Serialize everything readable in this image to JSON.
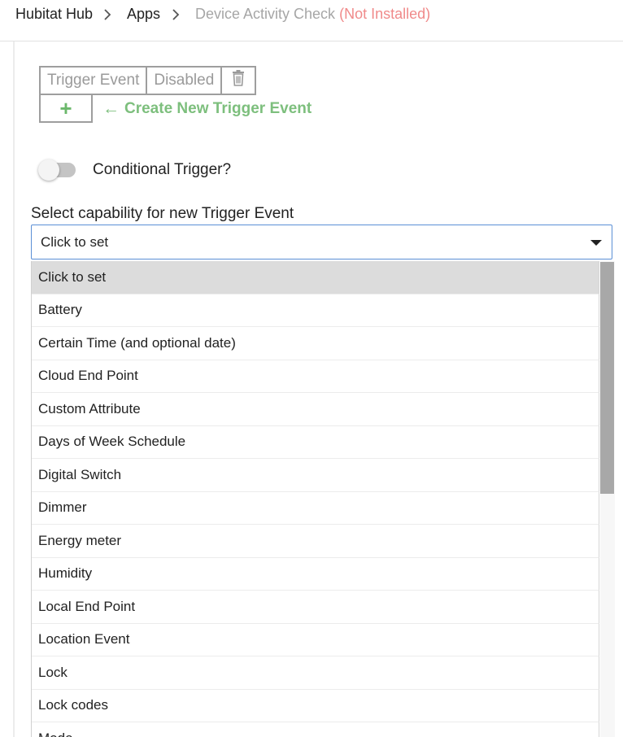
{
  "breadcrumb": {
    "hub": "Hubitat Hub",
    "apps": "Apps",
    "current": "Device Activity Check",
    "status": "(Not Installed)"
  },
  "trigger_table": {
    "event": "Trigger Event",
    "status": "Disabled",
    "add_symbol": "+",
    "create_arrow": "←",
    "create_label": "Create New Trigger Event"
  },
  "conditional": {
    "label": "Conditional Trigger?",
    "enabled": false
  },
  "capability_select": {
    "label": "Select capability for new Trigger Event",
    "value": "Click to set",
    "options": [
      "Click to set",
      "Battery",
      "Certain Time (and optional date)",
      "Cloud End Point",
      "Custom Attribute",
      "Days of Week Schedule",
      "Digital Switch",
      "Dimmer",
      "Energy meter",
      "Humidity",
      "Local End Point",
      "Location Event",
      "Lock",
      "Lock codes",
      "Mode"
    ]
  },
  "colors": {
    "accent_green": "#7dbf7d",
    "not_installed_red": "#f08a8a",
    "focus_border": "#5b8fd6"
  },
  "icons": [
    "chevron-right-icon",
    "trash-icon",
    "caret-down-icon"
  ]
}
